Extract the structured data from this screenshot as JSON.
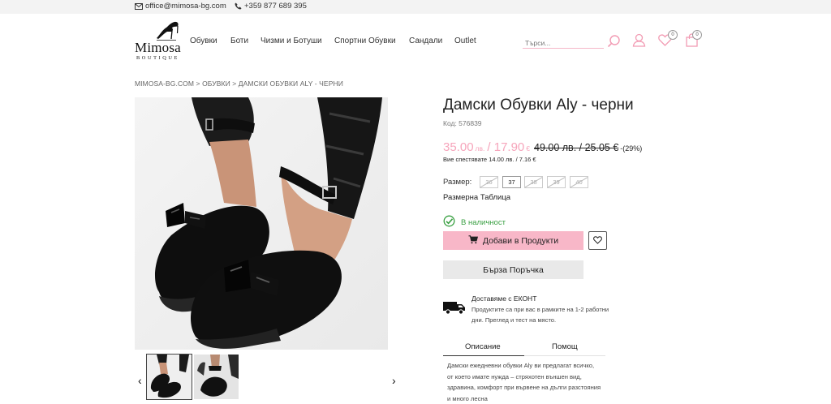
{
  "topbar": {
    "email": "office@mimosa-bg.com",
    "phone": "+359 877 689 395"
  },
  "logo": {
    "name": "Mimosa",
    "tagline": "BOUTIQUE"
  },
  "nav": {
    "items": [
      "Обувки",
      "Боти",
      "Чизми и Ботуши",
      "Спортни Обувки",
      "Сандали",
      "Outlet"
    ]
  },
  "header": {
    "search_placeholder": "Търси...",
    "wishlist_count": "0",
    "cart_count": "0"
  },
  "breadcrumb": "MIMOSA-BG.COM > ОБУВКИ > ДАМСКИ ОБУВКИ ALY - ЧЕРНИ",
  "gallery": {
    "prev_arrow": "‹",
    "next_arrow": "›",
    "thumbnail_count": 2
  },
  "product": {
    "title": "Дамски Обувки Aly - черни",
    "code": "Код: 576839",
    "price_new": "35.00",
    "price_new_unit": "лв.",
    "price_new_eur": "/ 17.90",
    "price_new_eur_unit": "€",
    "price_old": "49.00 лв. / 25.05 €",
    "discount": "-(29%)",
    "savings": "Вие спестявате 14.00 лв. / 7.16 €",
    "size_label": "Размер:",
    "sizes": [
      {
        "label": "36",
        "available": false
      },
      {
        "label": "37",
        "available": true
      },
      {
        "label": "38",
        "available": false
      },
      {
        "label": "39",
        "available": false
      },
      {
        "label": "40",
        "available": false
      }
    ],
    "size_table": "Размерна Таблица",
    "stock": "В наличност",
    "add_to_cart": "Добави в Продукти",
    "quick_order": "Бърза Поръчка"
  },
  "delivery": {
    "title": "Доставяме с ЕКОНТ",
    "text": "Продуктите са при вас в рамките на 1-2 работни дни. Преглед и тест на място."
  },
  "tabs": [
    "Описание",
    "Помощ"
  ],
  "description": "Дамски ежедневни обувки Aly ви предлагат всичко, от което имате нужда – стряхотен външен вид, здравина, комфорт при вървене на дълги разстояния и много лесна",
  "colors": {
    "accent_pink": "#f8b7c8",
    "price_pink": "#f6a5bb",
    "stock_green": "#3aa043"
  },
  "icons": [
    "mail-icon",
    "phone-icon",
    "search-icon",
    "user-icon",
    "heart-icon",
    "bag-icon",
    "cart-icon",
    "check-circle-icon",
    "truck-icon"
  ]
}
